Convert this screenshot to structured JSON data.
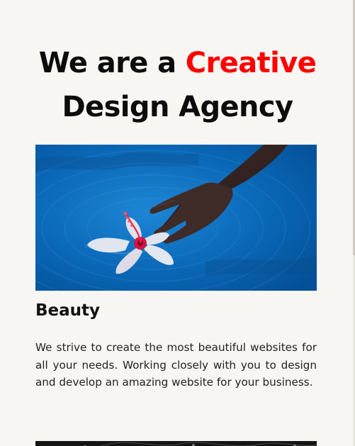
{
  "hero": {
    "title_line1_prefix": "We are a ",
    "title_line1_accent": "Creative",
    "title_line2": "Design Agency",
    "accent_color": "#ff0000",
    "image_subject": "hand-touching-water-with-hibiscus-flower"
  },
  "section": {
    "title": "Beauty",
    "body": "We strive to create the most beautiful websites for all your needs. Working closely with you to design and develop an amazing website for your business."
  },
  "next_section": {
    "image_subject": "dark-monochrome-photo"
  },
  "colors": {
    "background": "#f8f6f2",
    "text": "#111111",
    "accent": "#ff0000",
    "water": "#0a66b8"
  }
}
